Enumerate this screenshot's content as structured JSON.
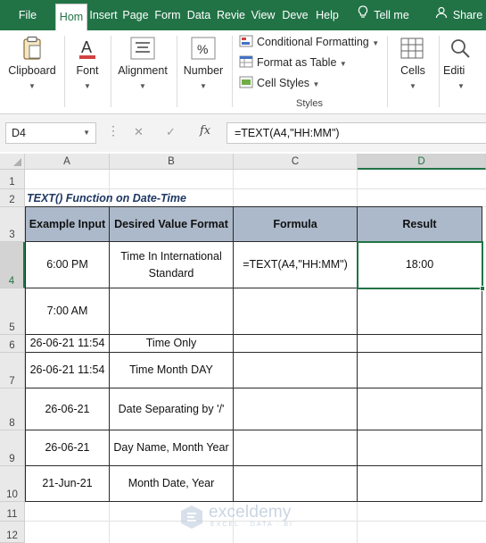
{
  "ribbon_tabs": [
    {
      "label": "File",
      "active": false
    },
    {
      "label": "Hom",
      "active": true
    },
    {
      "label": "Insert",
      "active": false
    },
    {
      "label": "Page",
      "active": false
    },
    {
      "label": "Form",
      "active": false
    },
    {
      "label": "Data",
      "active": false
    },
    {
      "label": "Revie",
      "active": false
    },
    {
      "label": "View",
      "active": false
    },
    {
      "label": "Deve",
      "active": false
    },
    {
      "label": "Help",
      "active": false
    },
    {
      "label": "Tell me",
      "active": false,
      "icon": "lightbulb-icon"
    },
    {
      "label": "Share",
      "active": false,
      "icon": "person-icon"
    }
  ],
  "ribbon_groups": {
    "clipboard": {
      "label": "Clipboard",
      "icon": "clipboard-icon"
    },
    "font": {
      "label": "Font",
      "icon": "font-icon"
    },
    "alignment": {
      "label": "Alignment",
      "icon": "alignment-icon"
    },
    "number": {
      "label": "Number",
      "icon": "percent-icon"
    },
    "styles": {
      "label": "Styles",
      "items": [
        {
          "label": "Conditional Formatting",
          "icon": "conditional-formatting-icon"
        },
        {
          "label": "Format as Table",
          "icon": "format-as-table-icon"
        },
        {
          "label": "Cell Styles",
          "icon": "cell-styles-icon"
        }
      ]
    },
    "cells": {
      "label": "Cells",
      "icon": "cells-icon"
    },
    "editing": {
      "label": "Editi",
      "icon": "search-icon"
    }
  },
  "formula_bar": {
    "name_box": "D4",
    "fx_label": "fx",
    "formula": "=TEXT(A4,\"HH:MM\")"
  },
  "sheet": {
    "columns": [
      "A",
      "B",
      "C",
      "D"
    ],
    "selected_column": "D",
    "rows": [
      "1",
      "2",
      "3",
      "4",
      "5",
      "6",
      "7",
      "8",
      "9",
      "10",
      "11",
      "12"
    ],
    "selected_row": "4",
    "title": "TEXT() Function on Date-Time",
    "headers": [
      "Example Input",
      "Desired Value Format",
      "Formula",
      "Result"
    ],
    "data_rows": [
      {
        "input": "6:00 PM",
        "format": "Time In International Standard",
        "formula": "=TEXT(A4,\"HH:MM\")",
        "result": "18:00"
      },
      {
        "input": "7:00 AM",
        "format": "",
        "formula": "",
        "result": ""
      },
      {
        "input": "26-06-21 11:54",
        "format": "Time Only",
        "formula": "",
        "result": ""
      },
      {
        "input": "26-06-21 11:54",
        "format": "Time Month DAY",
        "formula": "",
        "result": ""
      },
      {
        "input": "26-06-21",
        "format": "Date Separating by '/'",
        "formula": "",
        "result": ""
      },
      {
        "input": "26-06-21",
        "format": "Day Name, Month Year",
        "formula": "",
        "result": ""
      },
      {
        "input": "21-Jun-21",
        "format": "Month Date, Year",
        "formula": "",
        "result": ""
      }
    ]
  },
  "watermark": {
    "name": "exceldemy",
    "tagline": "EXCEL · DATA · BI"
  },
  "colors": {
    "accent": "#217346",
    "header_fill": "#acb9ca",
    "title_text": "#1f3864"
  }
}
